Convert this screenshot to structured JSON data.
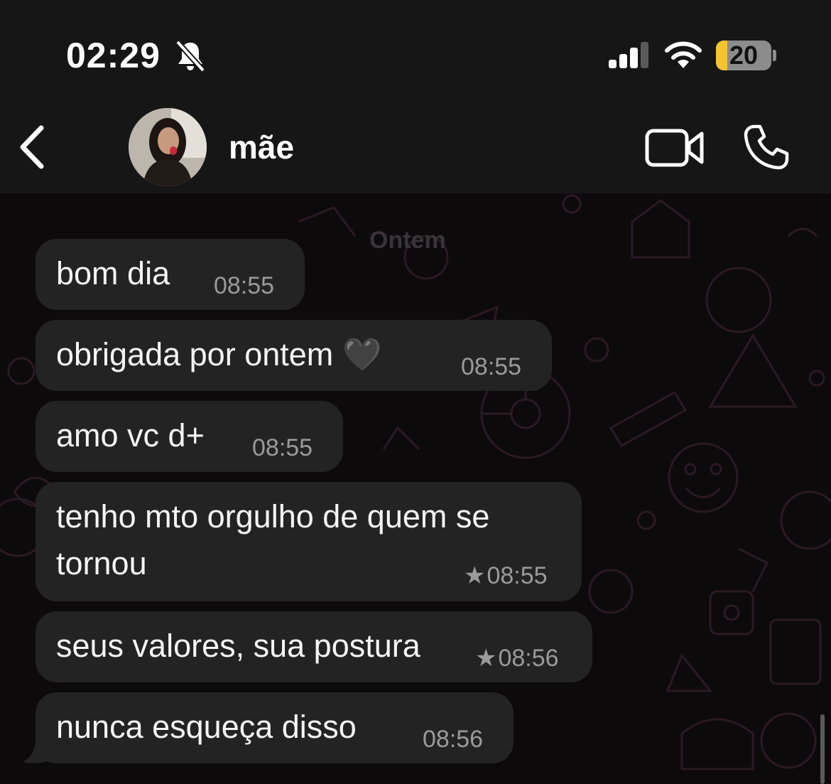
{
  "status_bar": {
    "time": "02:29",
    "battery_percent": "20",
    "battery_level": 0.2
  },
  "header": {
    "contact_name": "mãe"
  },
  "chat": {
    "date_label": "Ontem",
    "messages": [
      {
        "text": "bom dia",
        "time": "08:55",
        "starred": false
      },
      {
        "text": "obrigada por ontem 🖤",
        "time": "08:55",
        "starred": false
      },
      {
        "text": "amo vc d+",
        "time": "08:55",
        "starred": false
      },
      {
        "text": "tenho mto orgulho de quem se",
        "text2": "tornou",
        "time": "08:55",
        "starred": true
      },
      {
        "text": "seus valores, sua postura",
        "time": "08:56",
        "starred": true
      },
      {
        "text": "nunca esqueça disso",
        "time": "08:56",
        "starred": false
      }
    ]
  },
  "colors": {
    "header_bg": "#161616",
    "bubble_bg": "#232323",
    "battery_fill": "#f4c430",
    "wallpaper_pattern": "#2a1a24"
  },
  "icons": [
    "bell-off-icon",
    "signal-icon",
    "wifi-icon",
    "battery-icon",
    "back-icon",
    "video-call-icon",
    "phone-icon",
    "star-icon"
  ]
}
